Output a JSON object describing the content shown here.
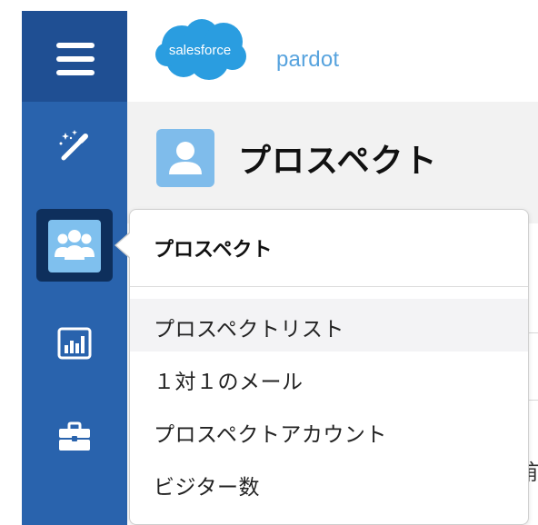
{
  "header": {
    "logo_cloud_text": "salesforce",
    "logo_product_text": "pardot"
  },
  "sidebar": {
    "items": [
      {
        "name": "menu",
        "icon": "hamburger-icon"
      },
      {
        "name": "marketing",
        "icon": "magic-wand-icon"
      },
      {
        "name": "prospects",
        "icon": "people-icon",
        "active": true
      },
      {
        "name": "reports",
        "icon": "bar-chart-icon"
      },
      {
        "name": "admin",
        "icon": "briefcase-icon"
      }
    ]
  },
  "page": {
    "title": "プロスペクト",
    "title_icon": "person-icon"
  },
  "background": {
    "partial_char": "前"
  },
  "popover": {
    "heading": "プロスペクト",
    "items": [
      {
        "label": "プロスペクトリスト",
        "highlighted": true
      },
      {
        "label": "１対１のメール"
      },
      {
        "label": "プロスペクトアカウント"
      },
      {
        "label": "ビジター数"
      }
    ]
  },
  "colors": {
    "sidebar": "#2963ad",
    "sidebar_top": "#1f4f93",
    "active_tile": "#7fc0ee",
    "brand_blue": "#57a3de",
    "title_bg": "#f2f2f2"
  }
}
